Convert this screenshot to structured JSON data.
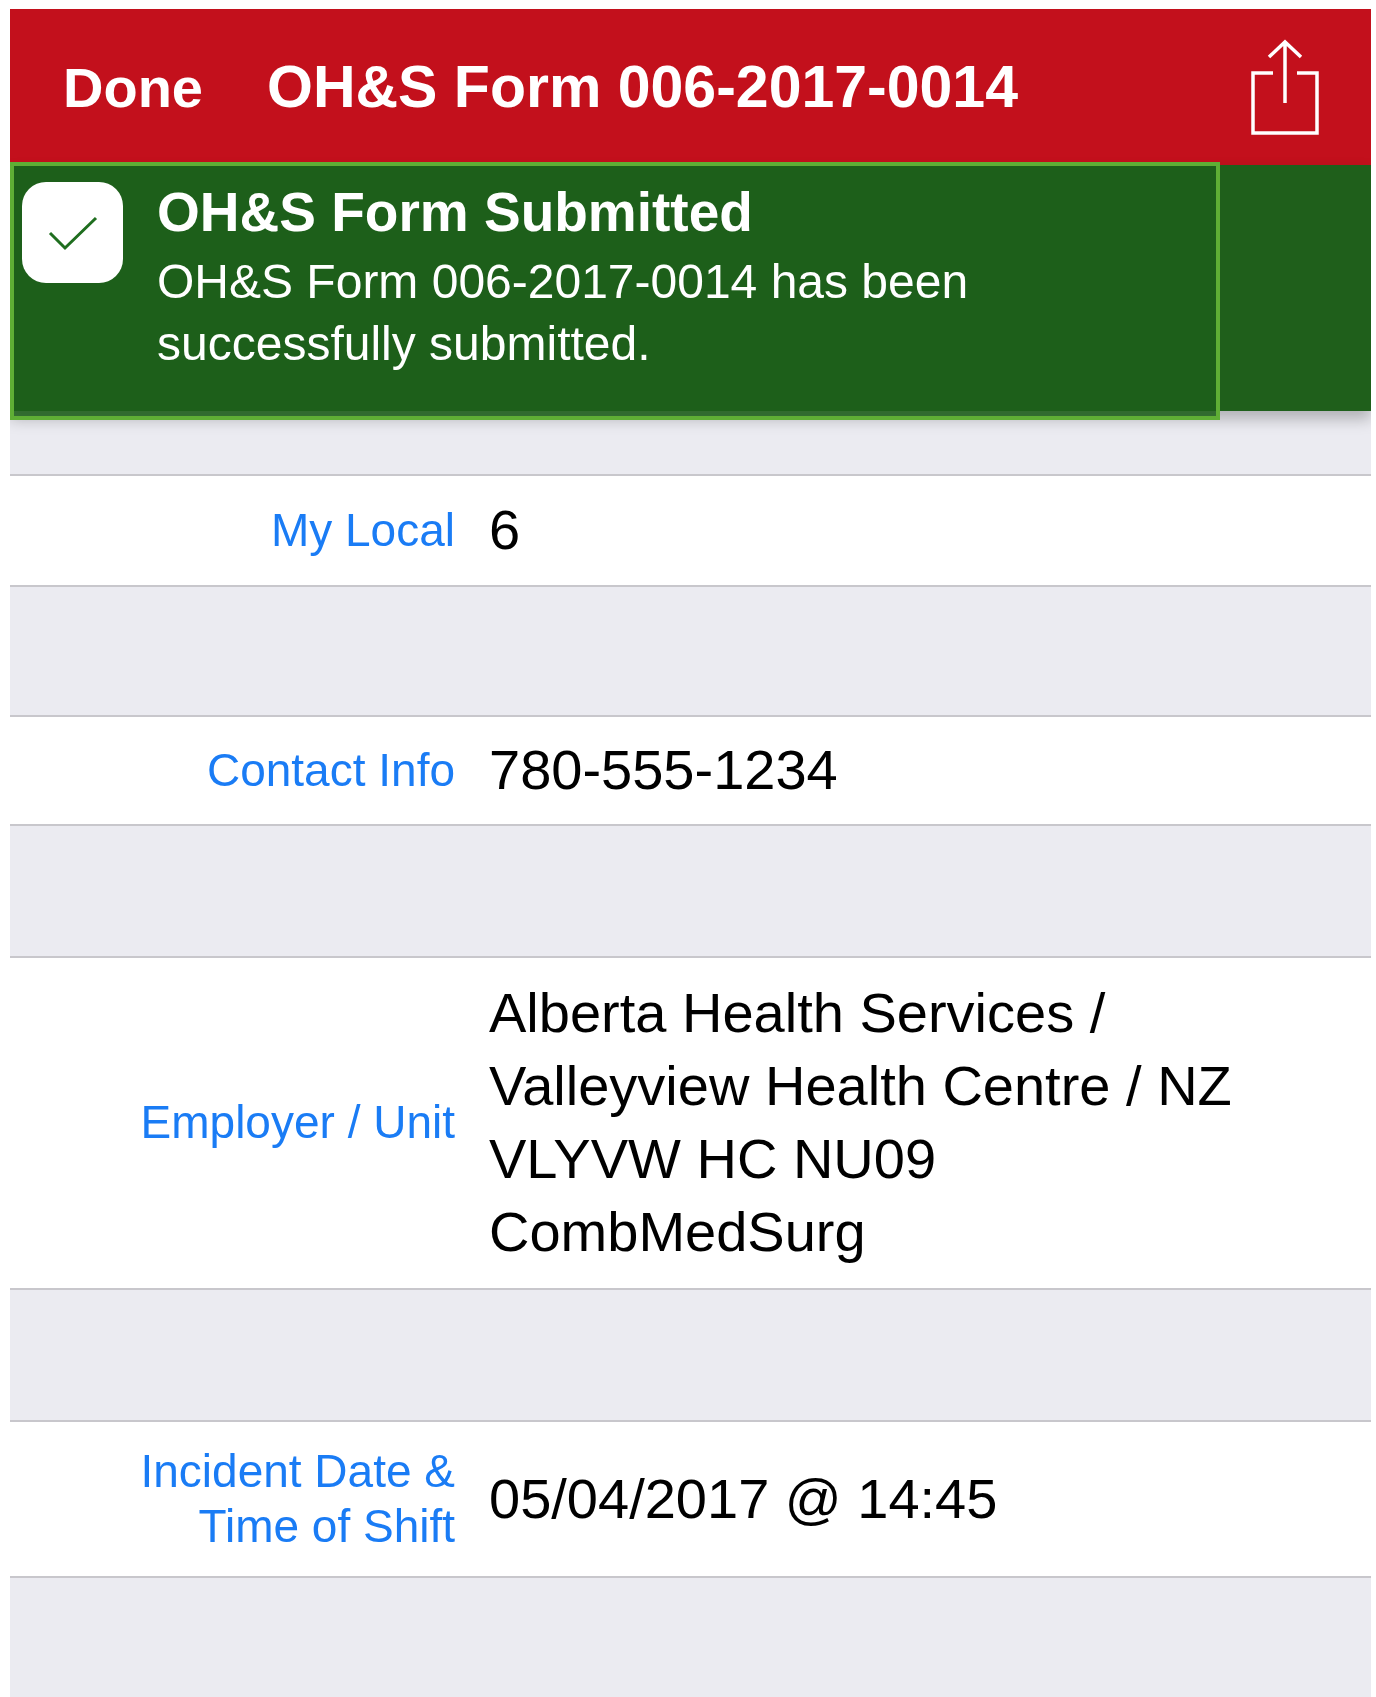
{
  "nav_bar": {
    "done_button": "Done",
    "title": "OH&S Form 006-2017-0014"
  },
  "notification": {
    "title": "OH&S Form Submitted",
    "message": "OH&S Form 006-2017-0014 has been successfully submitted."
  },
  "fields": [
    {
      "label": "My Local",
      "value": "6"
    },
    {
      "label": "Contact Info",
      "value": "780-555-1234"
    },
    {
      "label": "Employer / Unit",
      "value": "Alberta Health Services / Valleyview Health Centre / NZ VLYVW HC NU09 CombMedSurg"
    },
    {
      "label": "Incident Date & Time of Shift",
      "value": "05/04/2017 @ 14:45"
    }
  ]
}
